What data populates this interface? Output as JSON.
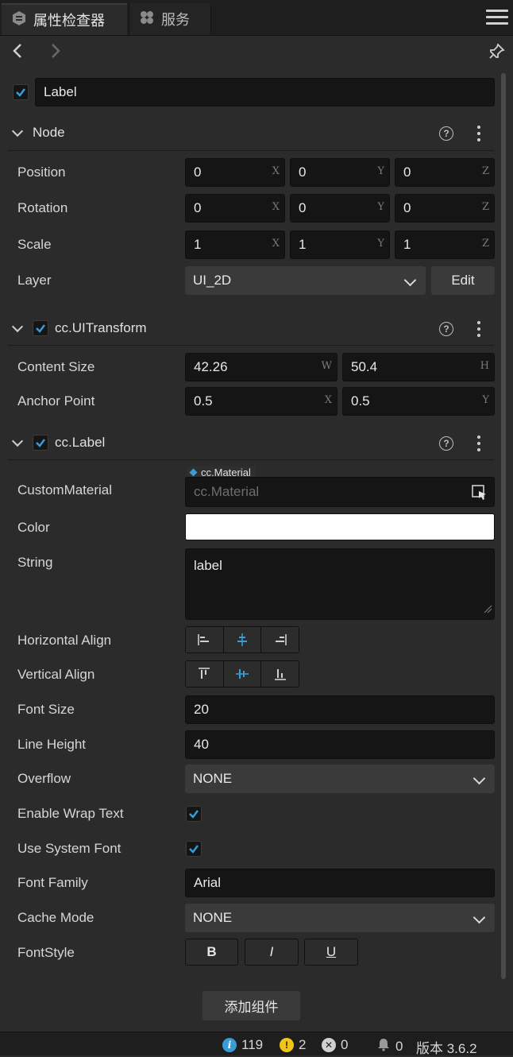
{
  "tabs": [
    {
      "label": "属性检查器",
      "icon": "inspector-icon",
      "active": true
    },
    {
      "label": "服务",
      "icon": "services-icon",
      "active": false
    }
  ],
  "node_name": "Label",
  "node_section": {
    "title": "Node",
    "position": {
      "label": "Position",
      "x": "0",
      "y": "0",
      "z": "0"
    },
    "rotation": {
      "label": "Rotation",
      "x": "0",
      "y": "0",
      "z": "0"
    },
    "scale": {
      "label": "Scale",
      "x": "1",
      "y": "1",
      "z": "1"
    },
    "layer": {
      "label": "Layer",
      "value": "UI_2D",
      "edit": "Edit"
    }
  },
  "axes": {
    "x": "X",
    "y": "Y",
    "z": "Z",
    "w": "W",
    "h": "H"
  },
  "uitransform": {
    "title": "cc.UITransform",
    "content_size": {
      "label": "Content Size",
      "w": "42.26",
      "h": "50.4"
    },
    "anchor_point": {
      "label": "Anchor Point",
      "x": "0.5",
      "y": "0.5"
    }
  },
  "label_comp": {
    "title": "cc.Label",
    "custom_material": {
      "label": "CustomMaterial",
      "tag": "cc.Material",
      "placeholder": "cc.Material"
    },
    "color": {
      "label": "Color",
      "value": "#ffffff"
    },
    "string": {
      "label": "String",
      "value": "label"
    },
    "horizontal_align": {
      "label": "Horizontal Align",
      "selected": 1
    },
    "vertical_align": {
      "label": "Vertical Align",
      "selected": 1
    },
    "font_size": {
      "label": "Font Size",
      "value": "20"
    },
    "line_height": {
      "label": "Line Height",
      "value": "40"
    },
    "overflow": {
      "label": "Overflow",
      "value": "NONE"
    },
    "enable_wrap": {
      "label": "Enable Wrap Text",
      "checked": true
    },
    "use_system_font": {
      "label": "Use System Font",
      "checked": true
    },
    "font_family": {
      "label": "Font Family",
      "value": "Arial"
    },
    "cache_mode": {
      "label": "Cache Mode",
      "value": "NONE"
    },
    "font_style": {
      "label": "FontStyle",
      "bold": "B",
      "italic": "I",
      "underline": "U"
    }
  },
  "add_component": "添加组件",
  "status": {
    "info": "119",
    "warn": "2",
    "error": "0",
    "notify": "0",
    "version": "版本 3.6.2"
  },
  "colors": {
    "accent": "#3a9bd5",
    "warn": "#f0c419"
  }
}
